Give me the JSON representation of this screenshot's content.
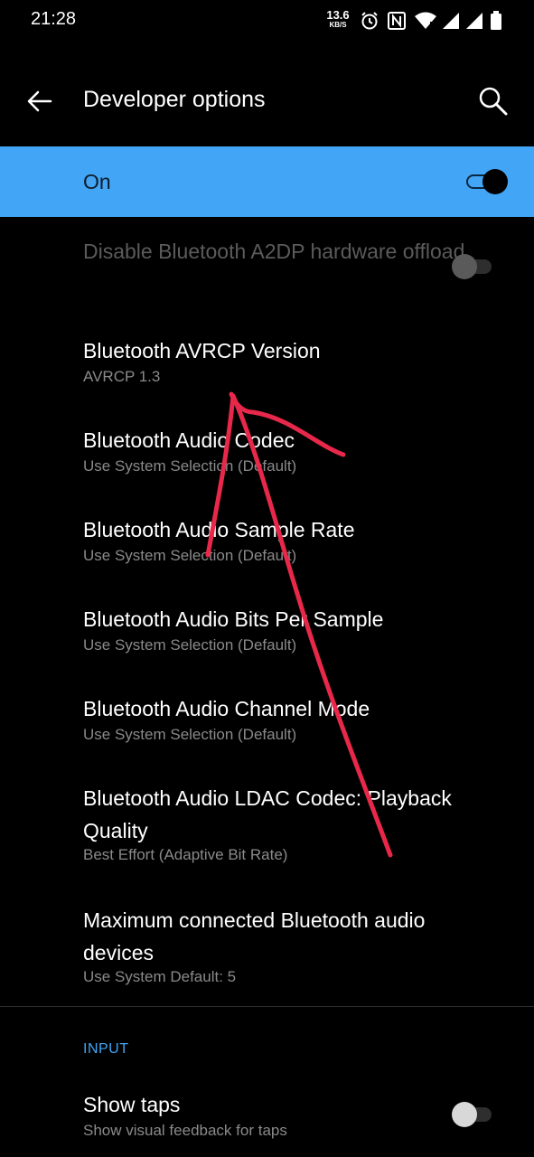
{
  "status_bar": {
    "time": "21:28",
    "net_speed_value": "13.6",
    "net_speed_unit": "KB/S",
    "icons": [
      "alarm-icon",
      "nfc-icon",
      "wifi-icon",
      "signal-icon",
      "signal-icon",
      "battery-icon"
    ]
  },
  "app_bar": {
    "title": "Developer options",
    "back_icon": "arrow-left-icon",
    "search_icon": "search-icon"
  },
  "master_switch": {
    "label": "On",
    "checked": true,
    "bg_color": "#42a5f5"
  },
  "settings": [
    {
      "title": "Disable Bluetooth A2DP hardware offload",
      "enabled": false,
      "toggle": false
    },
    {
      "title": "Bluetooth AVRCP Version",
      "summary": "AVRCP 1.3"
    },
    {
      "title": "Bluetooth Audio Codec",
      "summary": "Use System Selection (Default)"
    },
    {
      "title": "Bluetooth Audio Sample Rate",
      "summary": "Use System Selection (Default)"
    },
    {
      "title": "Bluetooth Audio Bits Per Sample",
      "summary": "Use System Selection (Default)"
    },
    {
      "title": "Bluetooth Audio Channel Mode",
      "summary": "Use System Selection (Default)"
    },
    {
      "title": "Bluetooth Audio LDAC Codec: Playback Quality",
      "summary": "Best Effort (Adaptive Bit Rate)"
    },
    {
      "title": "Maximum connected Bluetooth audio devices",
      "summary": "Use System Default: 5"
    }
  ],
  "input_section": {
    "header": "INPUT",
    "items": [
      {
        "title": "Show taps",
        "summary": "Show visual feedback for taps",
        "toggle": false
      }
    ]
  },
  "annotation": {
    "color": "#e8284a",
    "shape": "hand-drawn-arrow"
  }
}
